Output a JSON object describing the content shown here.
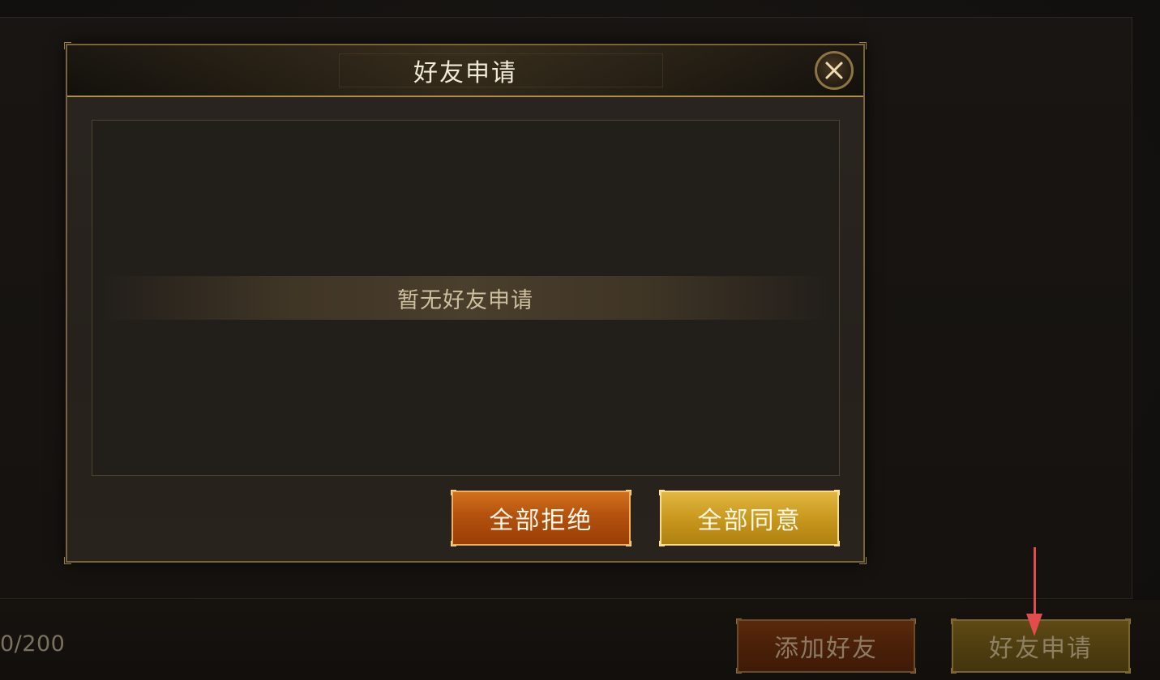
{
  "background": {
    "friend_count": "0/200",
    "add_friend_label": "添加好友",
    "friend_request_label": "好友申请"
  },
  "dialog": {
    "title": "好友申请",
    "empty_message": "暂无好友申请",
    "reject_all_label": "全部拒绝",
    "accept_all_label": "全部同意"
  },
  "annotation": {
    "arrow_color": "#e24c4c"
  },
  "colors": {
    "reject_button": "#b4520e",
    "accept_button": "#c9981e",
    "frame_gold": "#b08d48"
  }
}
